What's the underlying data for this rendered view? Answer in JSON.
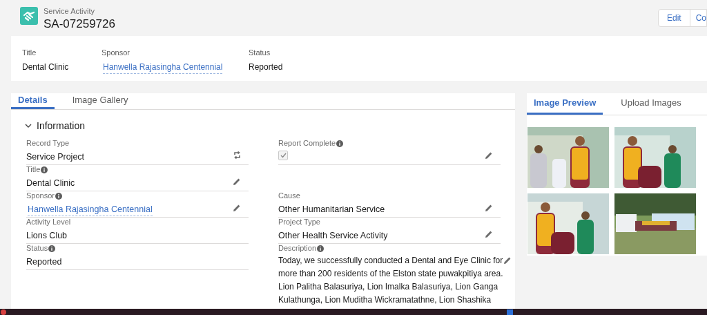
{
  "header": {
    "object_type": "Service Activity",
    "record_name": "SA-07259726",
    "buttons": [
      "Edit",
      "Co"
    ]
  },
  "highlights": [
    {
      "label": "Title",
      "value": "Dental Clinic",
      "kind": "text"
    },
    {
      "label": "Sponsor",
      "value": "Hanwella Rajasingha Centennial",
      "kind": "link"
    },
    {
      "label": "Status",
      "value": "Reported",
      "kind": "text"
    }
  ],
  "main_tabs": [
    {
      "label": "Details",
      "selected": true
    },
    {
      "label": "Image Gallery",
      "selected": false
    }
  ],
  "section": {
    "title": "Information",
    "expanded": true
  },
  "rows": [
    {
      "left": {
        "label": "Record Type",
        "info": false,
        "kind": "record_type",
        "value": "Service Project",
        "editable": false
      },
      "right": {
        "label": "Report Complete",
        "info": true,
        "kind": "checkbox",
        "checked": true,
        "editable": true
      }
    },
    {
      "left": {
        "label": "Title",
        "info": true,
        "kind": "text",
        "value": "Dental Clinic",
        "editable": true
      }
    },
    {
      "left": {
        "label": "Sponsor",
        "info": true,
        "kind": "link",
        "value": "Hanwella Rajasingha Centennial",
        "editable": true
      },
      "right": {
        "label": "Cause",
        "info": false,
        "kind": "text",
        "value": "Other Humanitarian Service",
        "editable": true
      }
    },
    {
      "left": {
        "label": "Activity Level",
        "info": false,
        "kind": "text",
        "value": "Lions Club",
        "editable": false
      },
      "right": {
        "label": "Project Type",
        "info": false,
        "kind": "text",
        "value": "Other Health Service Activity",
        "editable": true
      }
    },
    {
      "left": {
        "label": "Status",
        "info": true,
        "kind": "text",
        "value": "Reported",
        "editable": false
      },
      "right": {
        "label": "Description",
        "info": true,
        "kind": "description",
        "lines": [
          "Today, we successfully conducted a Dental and Eye Clinic for",
          "more than 200 residents of the Elston state puwakpitiya area.",
          "Lion Palitha Balasuriya, Lion Imalka Balasuriya, Lion Ganga",
          "Kulathunga, Lion Muditha Wickramatathne, Lion Shashika"
        ],
        "editable": true
      }
    }
  ],
  "side_tabs": [
    {
      "label": "Image Preview",
      "selected": true
    },
    {
      "label": "Upload Images",
      "selected": false
    }
  ]
}
